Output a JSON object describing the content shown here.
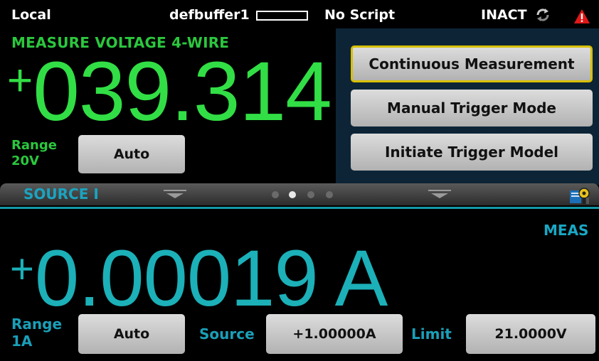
{
  "status_bar": {
    "mode": "Local",
    "buffer": "defbuffer1",
    "script": "No Script",
    "trigger_state": "INACT"
  },
  "measure": {
    "title": "MEASURE VOLTAGE 4-WIRE",
    "sign": "+",
    "value": "039.314",
    "range_label": "Range",
    "range_value": "20V",
    "range_button": "Auto",
    "color": "#32de45"
  },
  "menu": {
    "items": [
      {
        "label": "Continuous Measurement",
        "selected": true
      },
      {
        "label": "Manual Trigger Mode",
        "selected": false
      },
      {
        "label": "Initiate Trigger Model",
        "selected": false
      }
    ],
    "selected_border_color": "#d8bf00"
  },
  "swipe_bar": {
    "title": "SOURCE I",
    "pages": 4,
    "active_page": 2
  },
  "source": {
    "indicator": "MEAS",
    "sign": "+",
    "value": "0.00019 A",
    "range_label": "Range",
    "range_value": "1A",
    "range_button": "Auto",
    "source_label": "Source",
    "source_button": "+1.00000A",
    "limit_label": "Limit",
    "limit_button": "21.0000V",
    "color": "#1cb0b8"
  }
}
